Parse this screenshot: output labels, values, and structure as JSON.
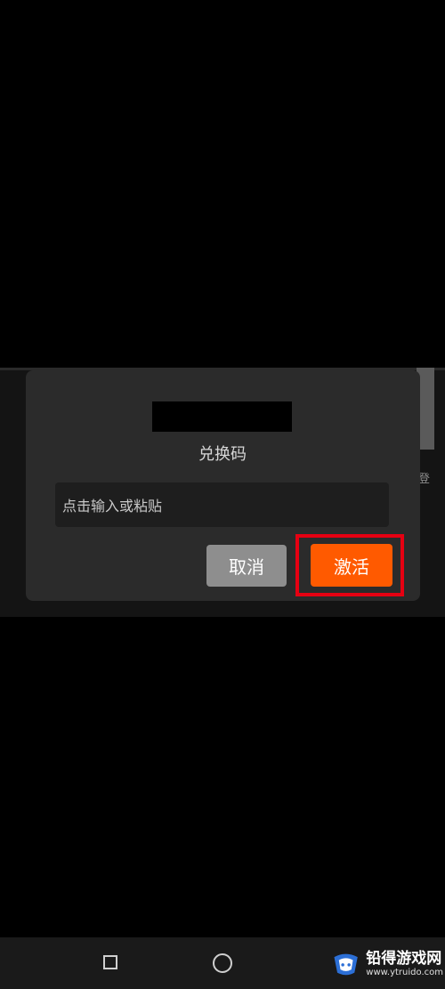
{
  "dialog": {
    "title": "兑换码",
    "input_placeholder": "点击输入或粘贴",
    "cancel_label": "取消",
    "activate_label": "激活"
  },
  "background": {
    "right_mark": "登"
  },
  "watermark": {
    "name": "铅得游戏网",
    "url": "www.ytruido.com"
  },
  "colors": {
    "activate": "#ff5a00",
    "cancel": "#8e8e8e",
    "highlight": "#e60012",
    "dialog": "#2b2b2b"
  },
  "icons": {
    "nav_recent": "square-icon",
    "nav_home": "circle-icon"
  }
}
